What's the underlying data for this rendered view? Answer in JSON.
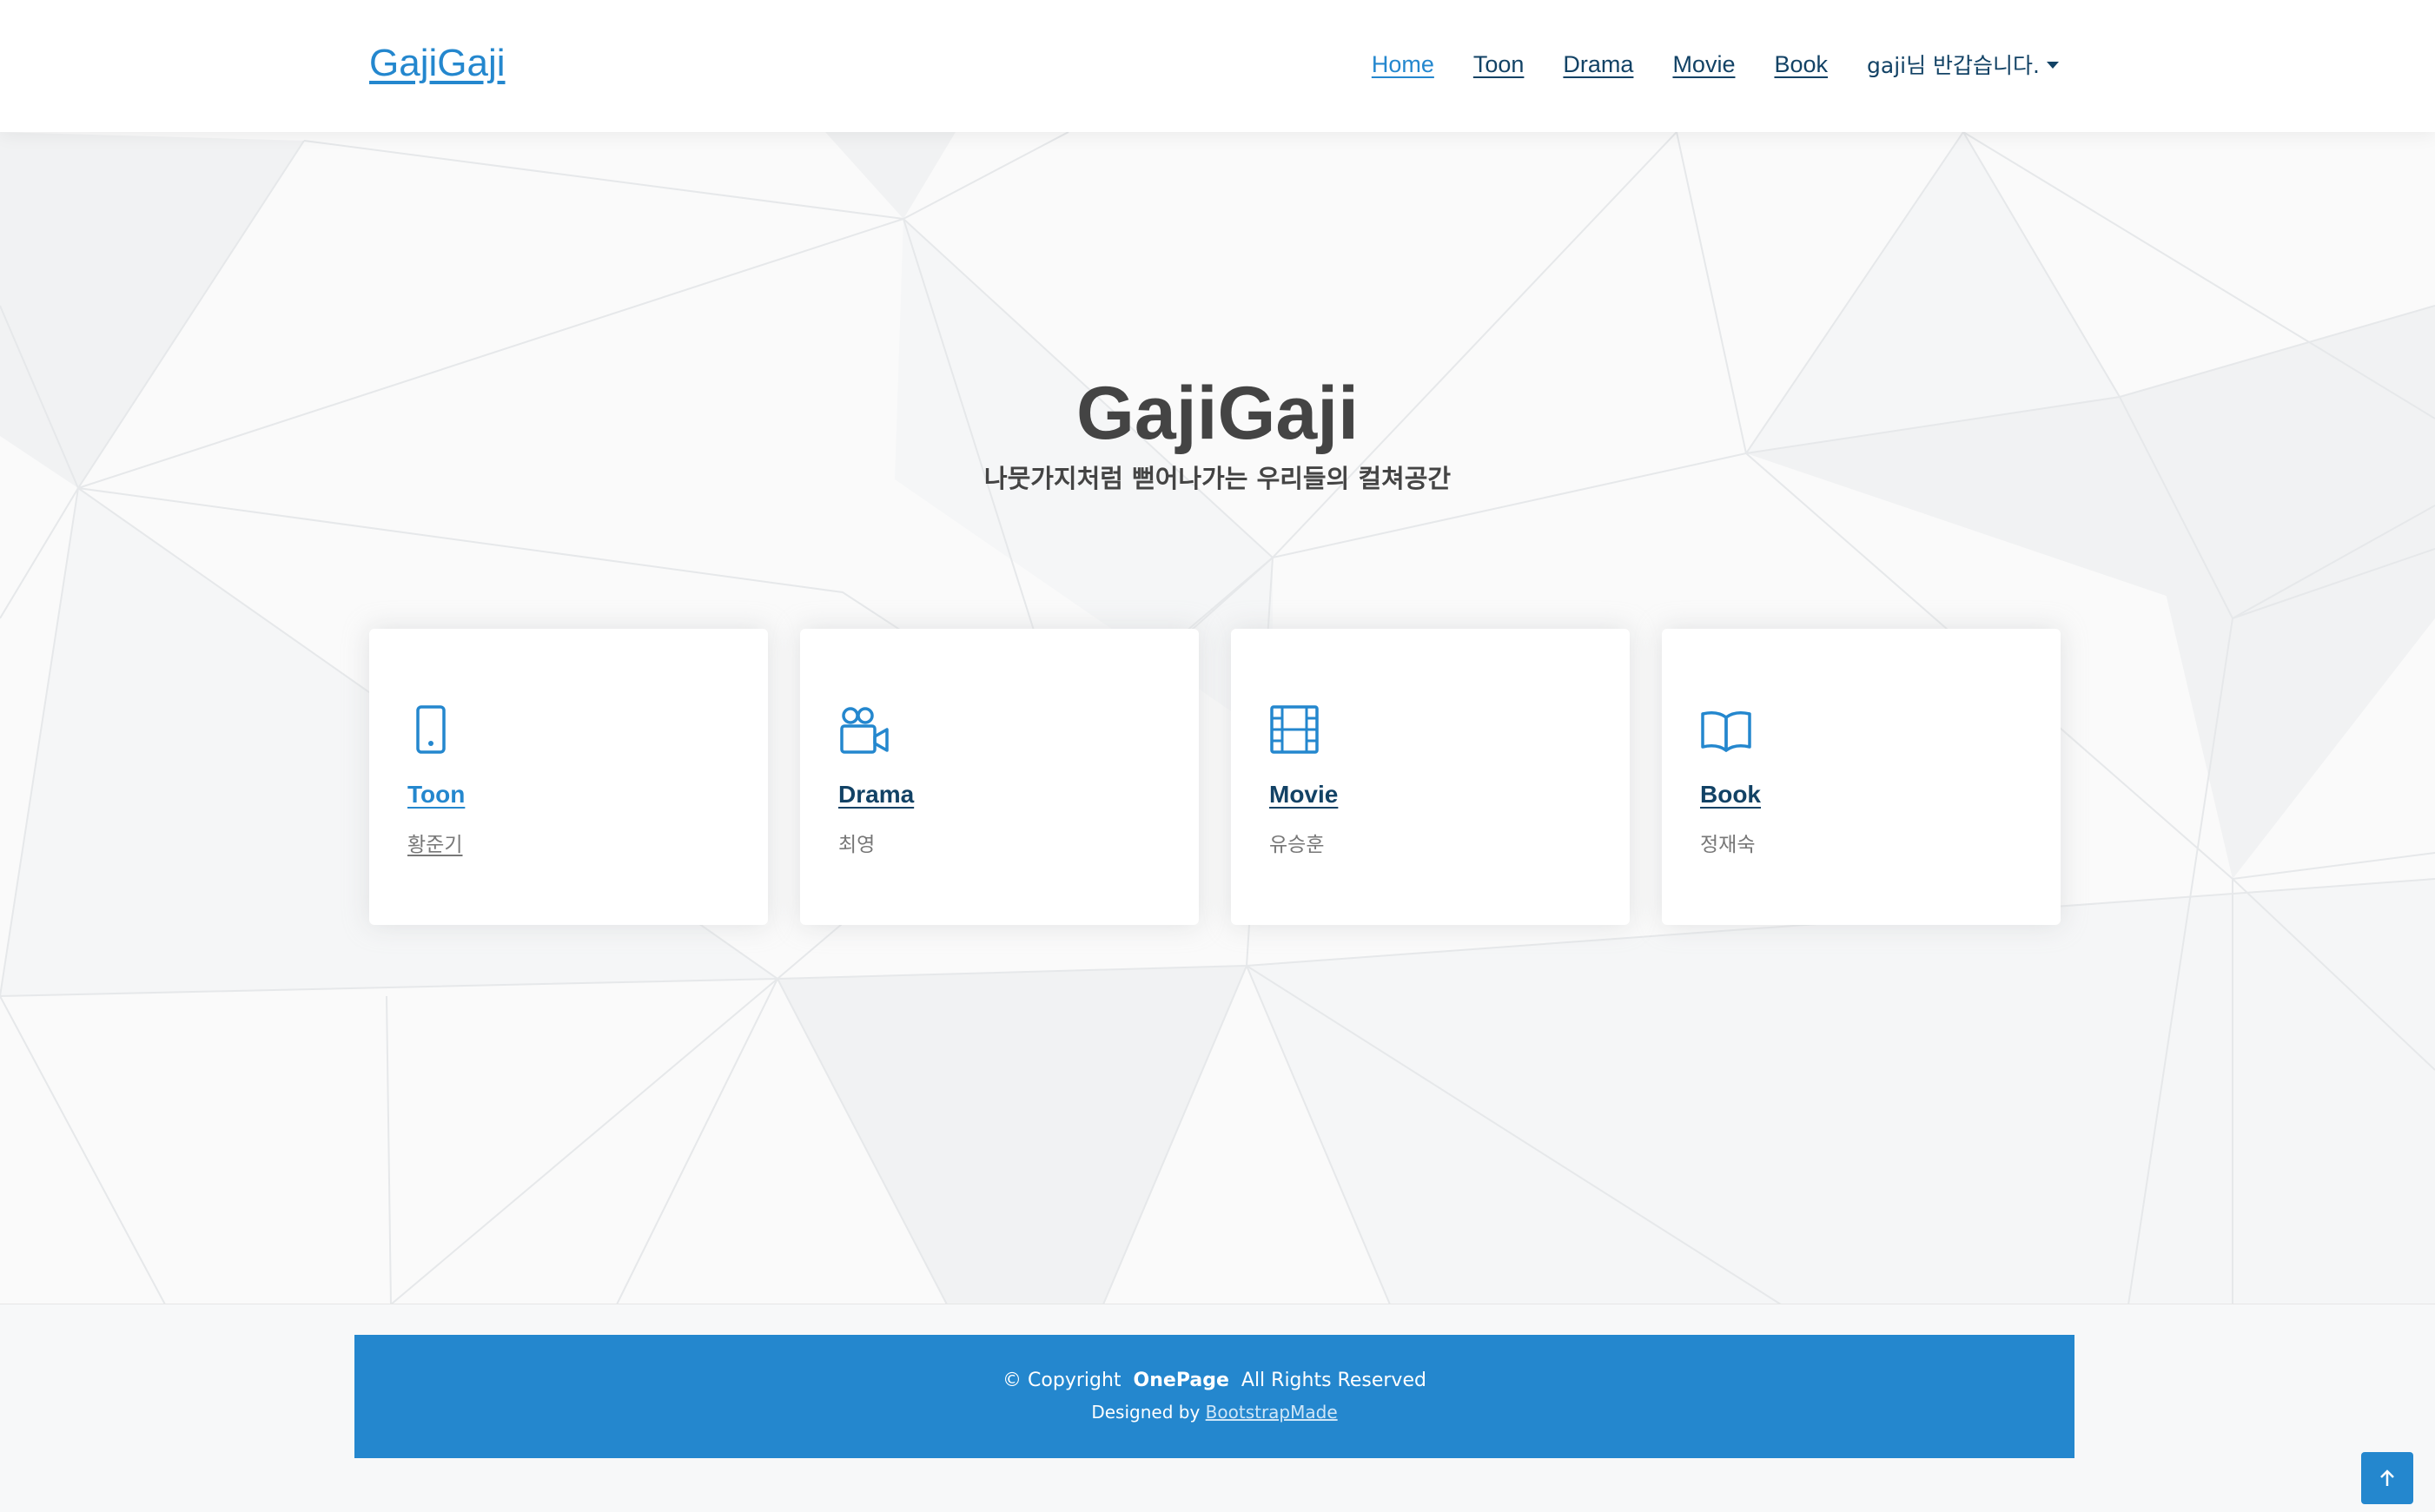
{
  "header": {
    "logo": "GajiGaji",
    "nav": [
      {
        "label": "Home",
        "active": true
      },
      {
        "label": "Toon"
      },
      {
        "label": "Drama"
      },
      {
        "label": "Movie"
      },
      {
        "label": "Book"
      }
    ],
    "user_greeting": "gaji님 반갑습니다."
  },
  "hero": {
    "title": "GajiGaji",
    "subtitle": "나뭇가지처럼 뻗어나가는 우리들의 컬쳐공간"
  },
  "cards": [
    {
      "title": "Toon",
      "author": "황준기",
      "icon": "phone-icon"
    },
    {
      "title": "Drama",
      "author": "최영",
      "icon": "camera-reels-icon"
    },
    {
      "title": "Movie",
      "author": "유승훈",
      "icon": "film-icon"
    },
    {
      "title": "Book",
      "author": "정재숙",
      "icon": "book-icon"
    }
  ],
  "footer": {
    "copyright_prefix": "© Copyright",
    "brand": "OnePage",
    "rights": "All Rights Reserved",
    "designed_by": "Designed by",
    "designer_link": "BootstrapMade"
  },
  "colors": {
    "accent": "#2487ce",
    "nav_text": "#124265",
    "title_text": "#444444"
  }
}
